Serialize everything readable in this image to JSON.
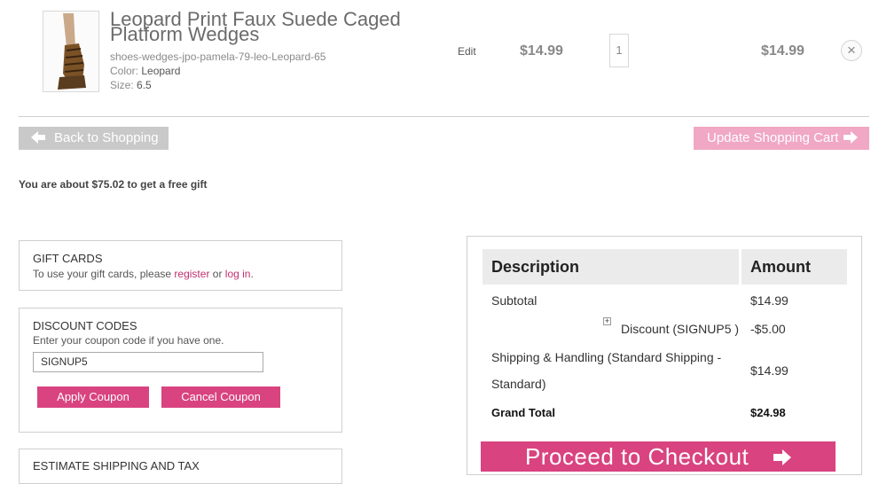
{
  "product": {
    "title": "Leopard Print Faux Suede Caged Platform Wedges",
    "sku": "shoes-wedges-jpo-pamela-79-leo-Leopard-65",
    "color_label": "Color:",
    "color_value": "Leopard",
    "size_label": "Size:",
    "size_value": "6.5",
    "edit_label": "Edit",
    "unit_price": "$14.99",
    "quantity": "1",
    "row_total": "$14.99",
    "remove_symbol": "×"
  },
  "actions": {
    "back_label": "Back to Shopping",
    "update_label": "Update Shopping Cart"
  },
  "free_gift_text": "You are about $75.02 to get a free gift",
  "gift_cards": {
    "title": "GIFT CARDS",
    "text_before": "To use your gift cards, please ",
    "register_link": "register",
    "text_or": " or ",
    "login_link": "log in",
    "text_after": "."
  },
  "discount_codes": {
    "title": "DISCOUNT CODES",
    "instruction": "Enter your coupon code if you have one.",
    "coupon_value": "SIGNUP5",
    "apply_label": "Apply Coupon",
    "cancel_label": "Cancel Coupon"
  },
  "estimate": {
    "title": "ESTIMATE SHIPPING AND TAX"
  },
  "summary": {
    "col_description": "Description",
    "col_amount": "Amount",
    "subtotal_label": "Subtotal",
    "subtotal_value": "$14.99",
    "discount_toggle": "+",
    "discount_label": "Discount (SIGNUP5 )",
    "discount_value": "-$5.00",
    "shipping_label_line1": "Shipping & Handling (Standard Shipping -",
    "shipping_label_line2": "Standard)",
    "shipping_value": "$14.99",
    "grand_total_label": "Grand Total",
    "grand_total_value": "$24.98",
    "checkout_label": "Proceed to Checkout"
  },
  "colors": {
    "accent_pink": "#d9437f",
    "light_pink": "#f0a8c4",
    "grey_button": "#c9c9c9",
    "link_pink": "#c0306f"
  },
  "icons": {
    "back": "arrow-left-icon",
    "update": "arrow-right-icon",
    "checkout": "arrow-right-icon",
    "remove": "close-icon"
  }
}
